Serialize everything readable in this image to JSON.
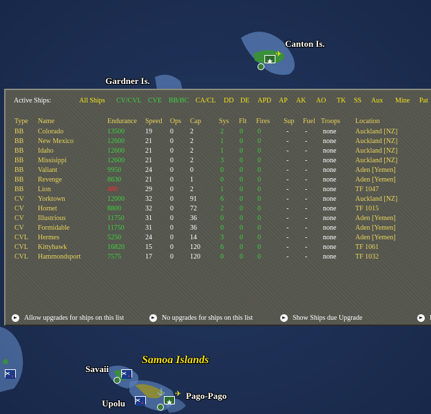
{
  "map": {
    "labels": {
      "canton": "Canton Is.",
      "gardner": "Gardner Is.",
      "samoa": "Samoa Islands",
      "savaii": "Savaii",
      "upolu": "Upolu",
      "pago": "Pago-Pago"
    }
  },
  "panel": {
    "title": "Active Ships:",
    "tabs": [
      "All Ships",
      "CV/CVL",
      "CVE",
      "BB/BC",
      "CA/CL",
      "DD",
      "DE",
      "APD",
      "AP",
      "AK",
      "AO",
      "TK",
      "SS",
      "Aux",
      "Mine",
      "Pat"
    ],
    "columns": [
      "Type",
      "Name",
      "Endurance",
      "Speed",
      "Ops",
      "Cap",
      "Sys",
      "Flt",
      "Fires",
      "Sup",
      "Fuel",
      "Troops",
      "Location"
    ],
    "rows": [
      {
        "type": "BB",
        "name": "Colorado",
        "endurance": "13500",
        "speed": "19",
        "ops": "0",
        "cap": "2",
        "sys": "2",
        "flt": "0",
        "fires": "0",
        "sup": "-",
        "fuel": "-",
        "troops": "none",
        "location": "Auckland [NZ]"
      },
      {
        "type": "BB",
        "name": "New Mexico",
        "endurance": "12600",
        "speed": "21",
        "ops": "0",
        "cap": "2",
        "sys": "1",
        "flt": "0",
        "fires": "0",
        "sup": "-",
        "fuel": "-",
        "troops": "none",
        "location": "Auckland [NZ]"
      },
      {
        "type": "BB",
        "name": "Idaho",
        "endurance": "12600",
        "speed": "21",
        "ops": "0",
        "cap": "2",
        "sys": "1",
        "flt": "0",
        "fires": "0",
        "sup": "-",
        "fuel": "-",
        "troops": "none",
        "location": "Auckland [NZ]"
      },
      {
        "type": "BB",
        "name": "Missisippi",
        "endurance": "12600",
        "speed": "21",
        "ops": "0",
        "cap": "2",
        "sys": "3",
        "flt": "0",
        "fires": "0",
        "sup": "-",
        "fuel": "-",
        "troops": "none",
        "location": "Auckland [NZ]"
      },
      {
        "type": "BB",
        "name": "Valiant",
        "endurance": "9950",
        "speed": "24",
        "ops": "0",
        "cap": "0",
        "sys": "0",
        "flt": "0",
        "fires": "0",
        "sup": "-",
        "fuel": "-",
        "troops": "none",
        "location": "Aden [Yemen]"
      },
      {
        "type": "BB",
        "name": "Revenge",
        "endurance": "8630",
        "speed": "21",
        "ops": "0",
        "cap": "1",
        "sys": "0",
        "flt": "0",
        "fires": "0",
        "sup": "-",
        "fuel": "-",
        "troops": "none",
        "location": "Aden [Yemen]"
      },
      {
        "type": "BB",
        "name": "Lion",
        "endurance": "480",
        "speed": "29",
        "ops": "0",
        "cap": "2",
        "sys": "1",
        "flt": "0",
        "fires": "0",
        "sup": "-",
        "fuel": "-",
        "troops": "none",
        "location": "TF 1047"
      },
      {
        "type": "CV",
        "name": "Yorktown",
        "endurance": "12000",
        "speed": "32",
        "ops": "0",
        "cap": "91",
        "sys": "6",
        "flt": "0",
        "fires": "0",
        "sup": "-",
        "fuel": "-",
        "troops": "none",
        "location": "Auckland [NZ]"
      },
      {
        "type": "CV",
        "name": "Hornet",
        "endurance": "8800",
        "speed": "32",
        "ops": "0",
        "cap": "72",
        "sys": "2",
        "flt": "0",
        "fires": "0",
        "sup": "-",
        "fuel": "-",
        "troops": "none",
        "location": "TF 1015"
      },
      {
        "type": "CV",
        "name": "Illustrious",
        "endurance": "11750",
        "speed": "31",
        "ops": "0",
        "cap": "36",
        "sys": "0",
        "flt": "0",
        "fires": "0",
        "sup": "-",
        "fuel": "-",
        "troops": "none",
        "location": "Aden [Yemen]"
      },
      {
        "type": "CV",
        "name": "Formidable",
        "endurance": "11750",
        "speed": "31",
        "ops": "0",
        "cap": "36",
        "sys": "0",
        "flt": "0",
        "fires": "0",
        "sup": "-",
        "fuel": "-",
        "troops": "none",
        "location": "Aden [Yemen]"
      },
      {
        "type": "CVL",
        "name": "Hermes",
        "endurance": "5250",
        "speed": "24",
        "ops": "0",
        "cap": "14",
        "sys": "3",
        "flt": "0",
        "fires": "0",
        "sup": "-",
        "fuel": "-",
        "troops": "none",
        "location": "Aden [Yemen]"
      },
      {
        "type": "CVL",
        "name": "Kittyhawk",
        "endurance": "16820",
        "speed": "15",
        "ops": "0",
        "cap": "120",
        "sys": "6",
        "flt": "0",
        "fires": "0",
        "sup": "-",
        "fuel": "-",
        "troops": "none",
        "location": "TF 1061"
      },
      {
        "type": "CVL",
        "name": "Hammondsport",
        "endurance": "7575",
        "speed": "17",
        "ops": "0",
        "cap": "120",
        "sys": "0",
        "flt": "0",
        "fires": "0",
        "sup": "-",
        "fuel": "-",
        "troops": "none",
        "location": "TF 1032"
      }
    ],
    "footer": {
      "allow": "Allow upgrades for ships on this list",
      "no": "No upgrades for ships on this list",
      "show": "Show Ships due Upgrade",
      "more": "I"
    }
  },
  "colors": {
    "ocean": "#1c2f52",
    "panel": "#55564e",
    "green_text": "#3fd23f",
    "yellow_text": "#e8d35a",
    "red_text": "#ff2a2a"
  }
}
